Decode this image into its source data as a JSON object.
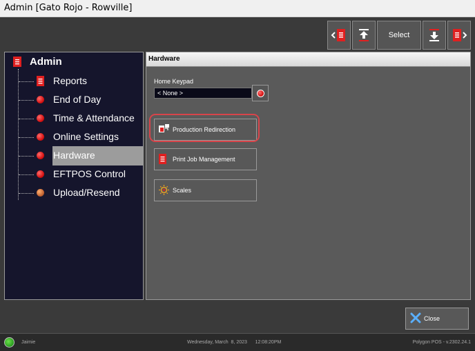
{
  "window": {
    "title": "Admin [Gato Rojo - Rowville]"
  },
  "toolbar": {
    "buttons": [
      {
        "name": "prev-document",
        "icon": "left-document-icon"
      },
      {
        "name": "move-top",
        "icon": "upload-arrow-icon"
      },
      {
        "name": "select",
        "label": "Select"
      },
      {
        "name": "move-bottom",
        "icon": "download-arrow-icon"
      },
      {
        "name": "next-document",
        "icon": "right-document-icon"
      }
    ]
  },
  "sidebar": {
    "title": "Admin",
    "items": [
      {
        "label": "Reports",
        "icon": "document-icon"
      },
      {
        "label": "End of Day",
        "icon": "red-dot-icon"
      },
      {
        "label": "Time & Attendance",
        "icon": "red-dot-icon"
      },
      {
        "label": "Online Settings",
        "icon": "red-dot-icon"
      },
      {
        "label": "Hardware",
        "icon": "red-dot-icon",
        "active": true
      },
      {
        "label": "EFTPOS Control",
        "icon": "red-dot-icon"
      },
      {
        "label": "Upload/Resend",
        "icon": "orange-dot-icon"
      }
    ]
  },
  "panel": {
    "header": "Hardware",
    "home_keypad": {
      "label": "Home Keypad",
      "value": "< None >"
    },
    "buttons": [
      {
        "label": "Production Redirection",
        "icon": "production-redirection-icon",
        "highlighted": true
      },
      {
        "label": "Print Job Management",
        "icon": "print-job-icon"
      },
      {
        "label": "Scales",
        "icon": "scales-icon"
      }
    ]
  },
  "close": {
    "label": "Close"
  },
  "status": {
    "user": "Jaimie",
    "datetime": "Wednesday, March  8, 2023      12:08:20PM",
    "version": "Polygon POS - v.2302.24.1"
  },
  "colors": {
    "accent_red": "#d41010",
    "highlight_ring": "#d8444a",
    "sidebar_bg": "#15152c",
    "panel_bg": "#5a5a5a"
  }
}
